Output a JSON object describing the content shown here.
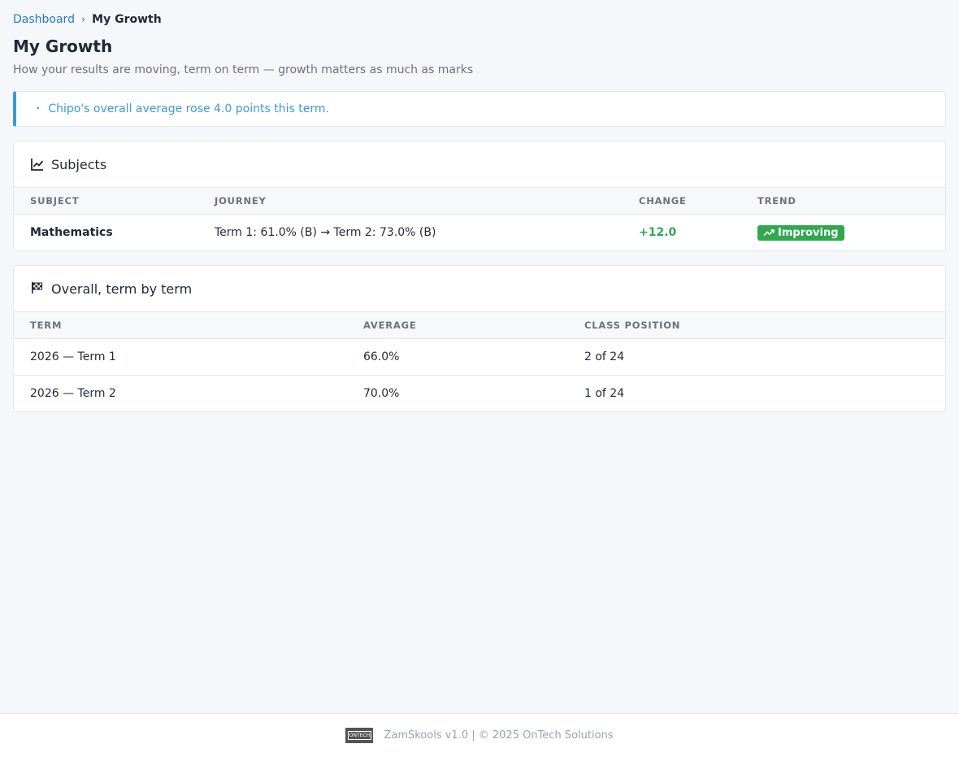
{
  "breadcrumb": {
    "home": "Dashboard",
    "separator": "›",
    "current": "My Growth"
  },
  "page": {
    "title": "My Growth",
    "subtitle": "How your results are moving, term on term — growth matters as much as marks"
  },
  "alert": {
    "bullet": "•",
    "message": "Chipo's overall average rose 4.0 points this term."
  },
  "subjects": {
    "title": "Subjects",
    "icon": "line-chart-icon",
    "columns": {
      "subject": "Subject",
      "journey": "Journey",
      "change": "Change",
      "trend": "Trend"
    },
    "rows": [
      {
        "subject": "Mathematics",
        "journey": "Term 1: 61.0% (B) → Term 2: 73.0% (B)",
        "change": "+12.0",
        "trend": "Improving"
      }
    ]
  },
  "overall": {
    "title": "Overall, term by term",
    "icon": "checkered-flag-icon",
    "columns": {
      "term": "Term",
      "average": "Average",
      "position": "Class Position"
    },
    "rows": [
      {
        "term": "2026 — Term 1",
        "average": "66.0%",
        "position": "2 of 24"
      },
      {
        "term": "2026 — Term 2",
        "average": "70.0%",
        "position": "1 of 24"
      }
    ]
  },
  "footer": {
    "logo_text": "ONTECH",
    "text": "ZamSkools v1.0 | © 2025 OnTech Solutions"
  },
  "colors": {
    "accent": "#1e7bc4",
    "info": "#3a9ad9",
    "success": "#2fa84f"
  }
}
